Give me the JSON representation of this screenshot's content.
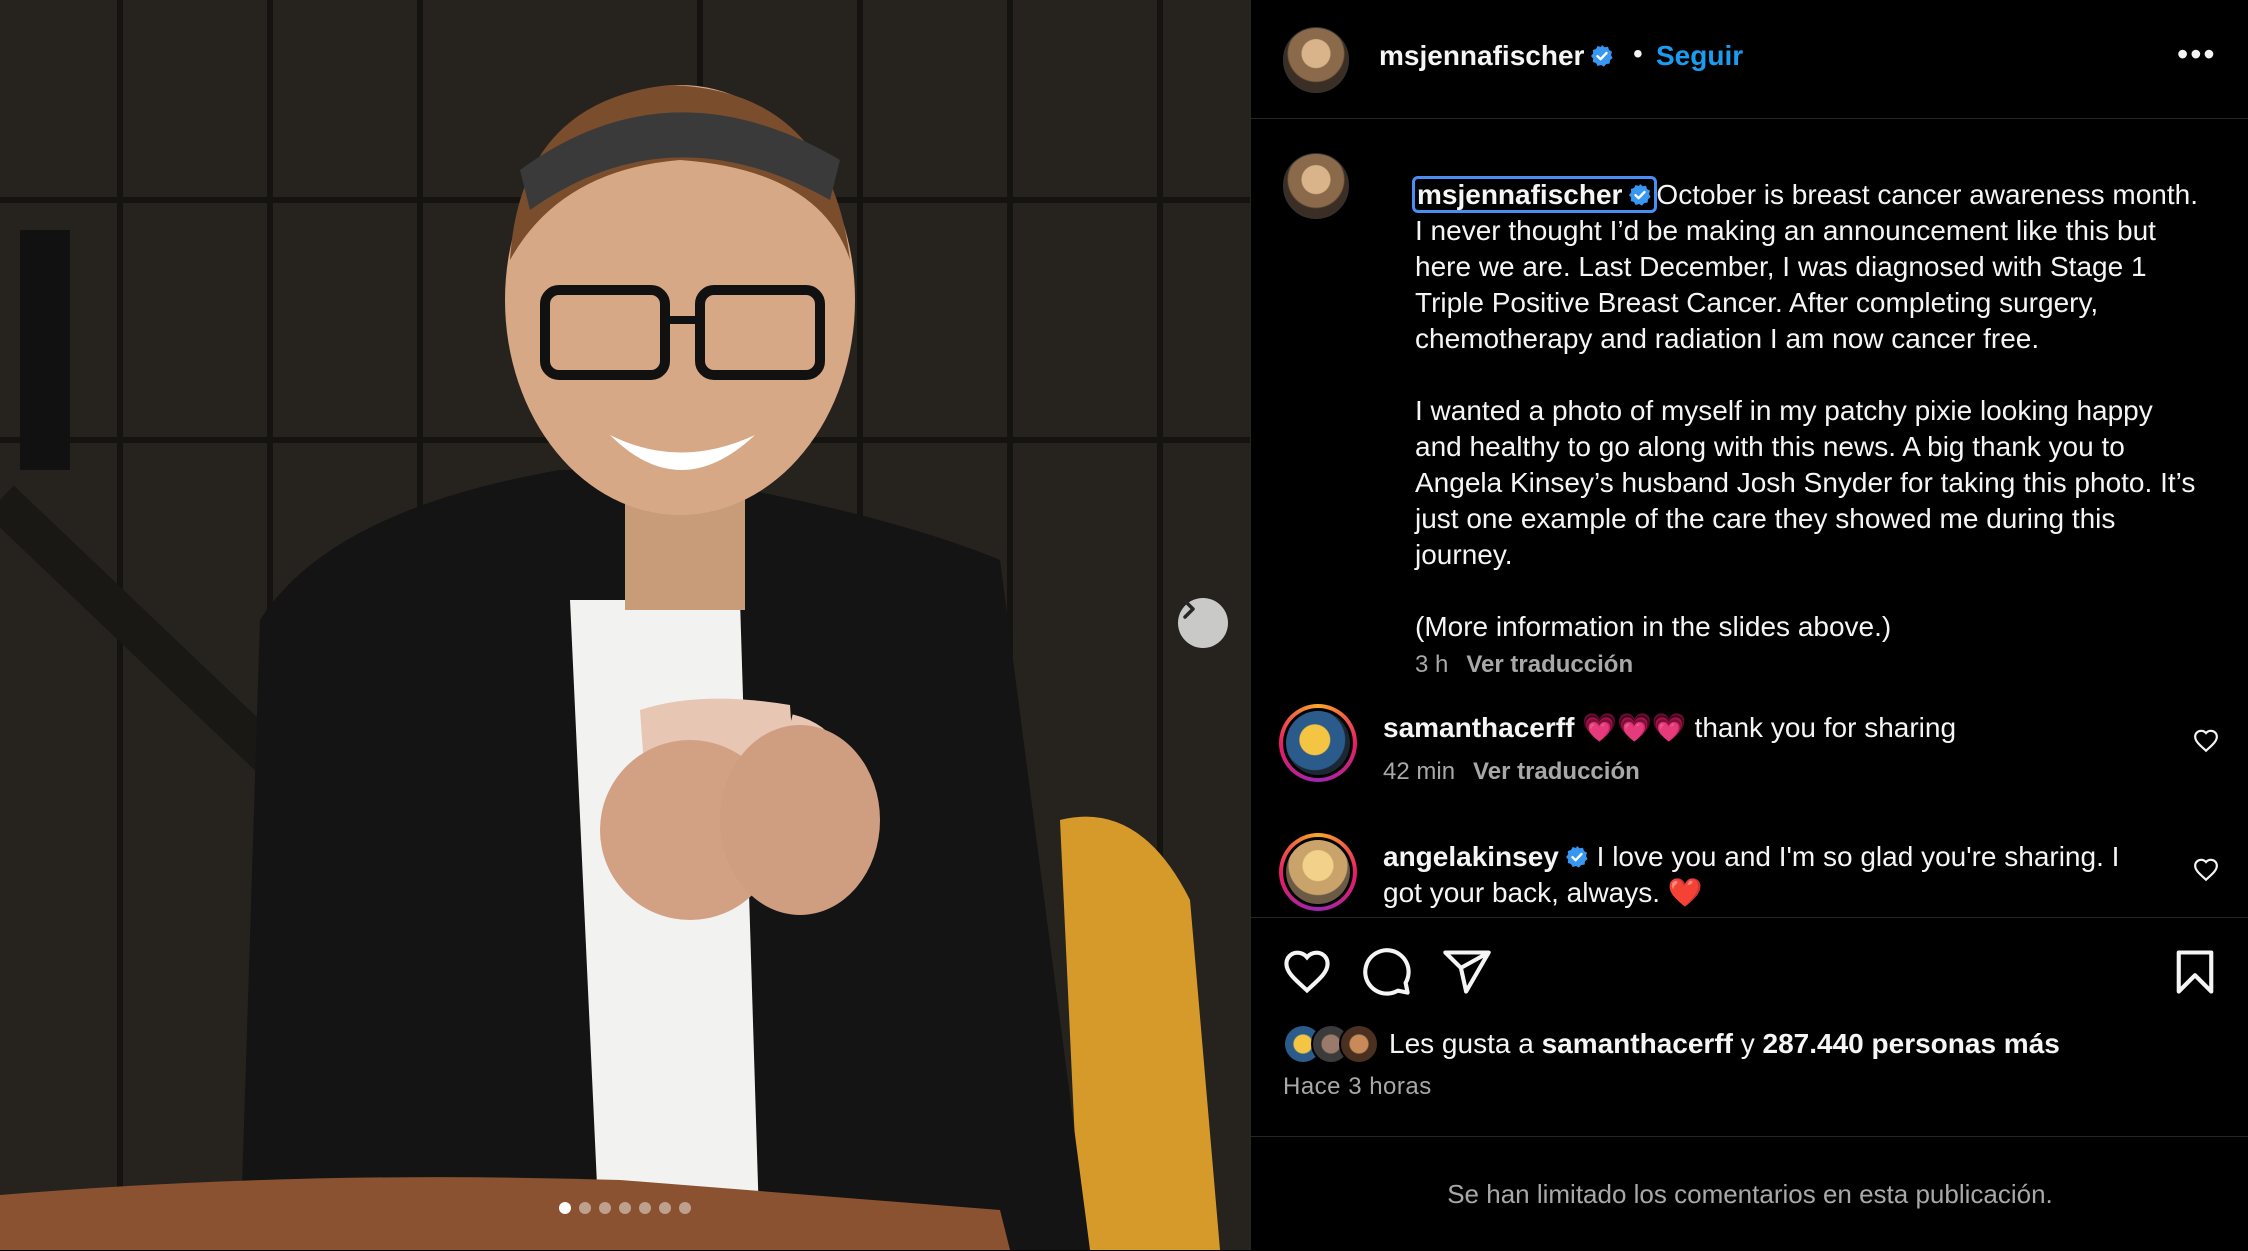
{
  "post": {
    "username": "msjennafischer",
    "separator": "•",
    "follow_label": "Seguir",
    "more_label": "•••",
    "caption": "October is breast cancer awareness month. I never thought I’d be making an announcement like this but here we are. Last December, I was diagnosed with Stage 1 Triple Positive Breast Cancer. After completing surgery, chemotherapy and radiation I am now cancer free.\n\nI wanted a photo of myself in my patchy pixie looking happy and healthy to go along with this news. A big thank you to Angela Kinsey’s husband Josh Snyder for taking this photo. It’s just one example of the care they showed me during this journey.\n\n(More information in the slides above.)",
    "caption_time": "3 h",
    "translate_label": "Ver traducción",
    "slide_count": 7,
    "active_slide": 1
  },
  "comments": [
    {
      "username": "samanthacerff",
      "text": "💗💗💗 thank you for sharing",
      "time": "42 min",
      "translate_label": "Ver traducción"
    },
    {
      "username": "angelakinsey",
      "text": "I love you and I'm so glad you're sharing. I got your back, always. ❤️"
    }
  ],
  "likes": {
    "prefix": "Les gusta a",
    "user": "samanthacerff",
    "joiner": "y",
    "count_text": "287.440 personas más"
  },
  "posted_ago": "Hace 3 horas",
  "comments_limited": "Se han limitado los comentarios en esta publicación.",
  "colors": {
    "accent": "#1a9cf0",
    "verified": "#3897f0",
    "muted": "#a8a8a8"
  },
  "icons": [
    "verified-icon",
    "more-icon",
    "chevron-right-icon",
    "heart-icon",
    "comment-icon",
    "share-icon",
    "bookmark-icon"
  ]
}
